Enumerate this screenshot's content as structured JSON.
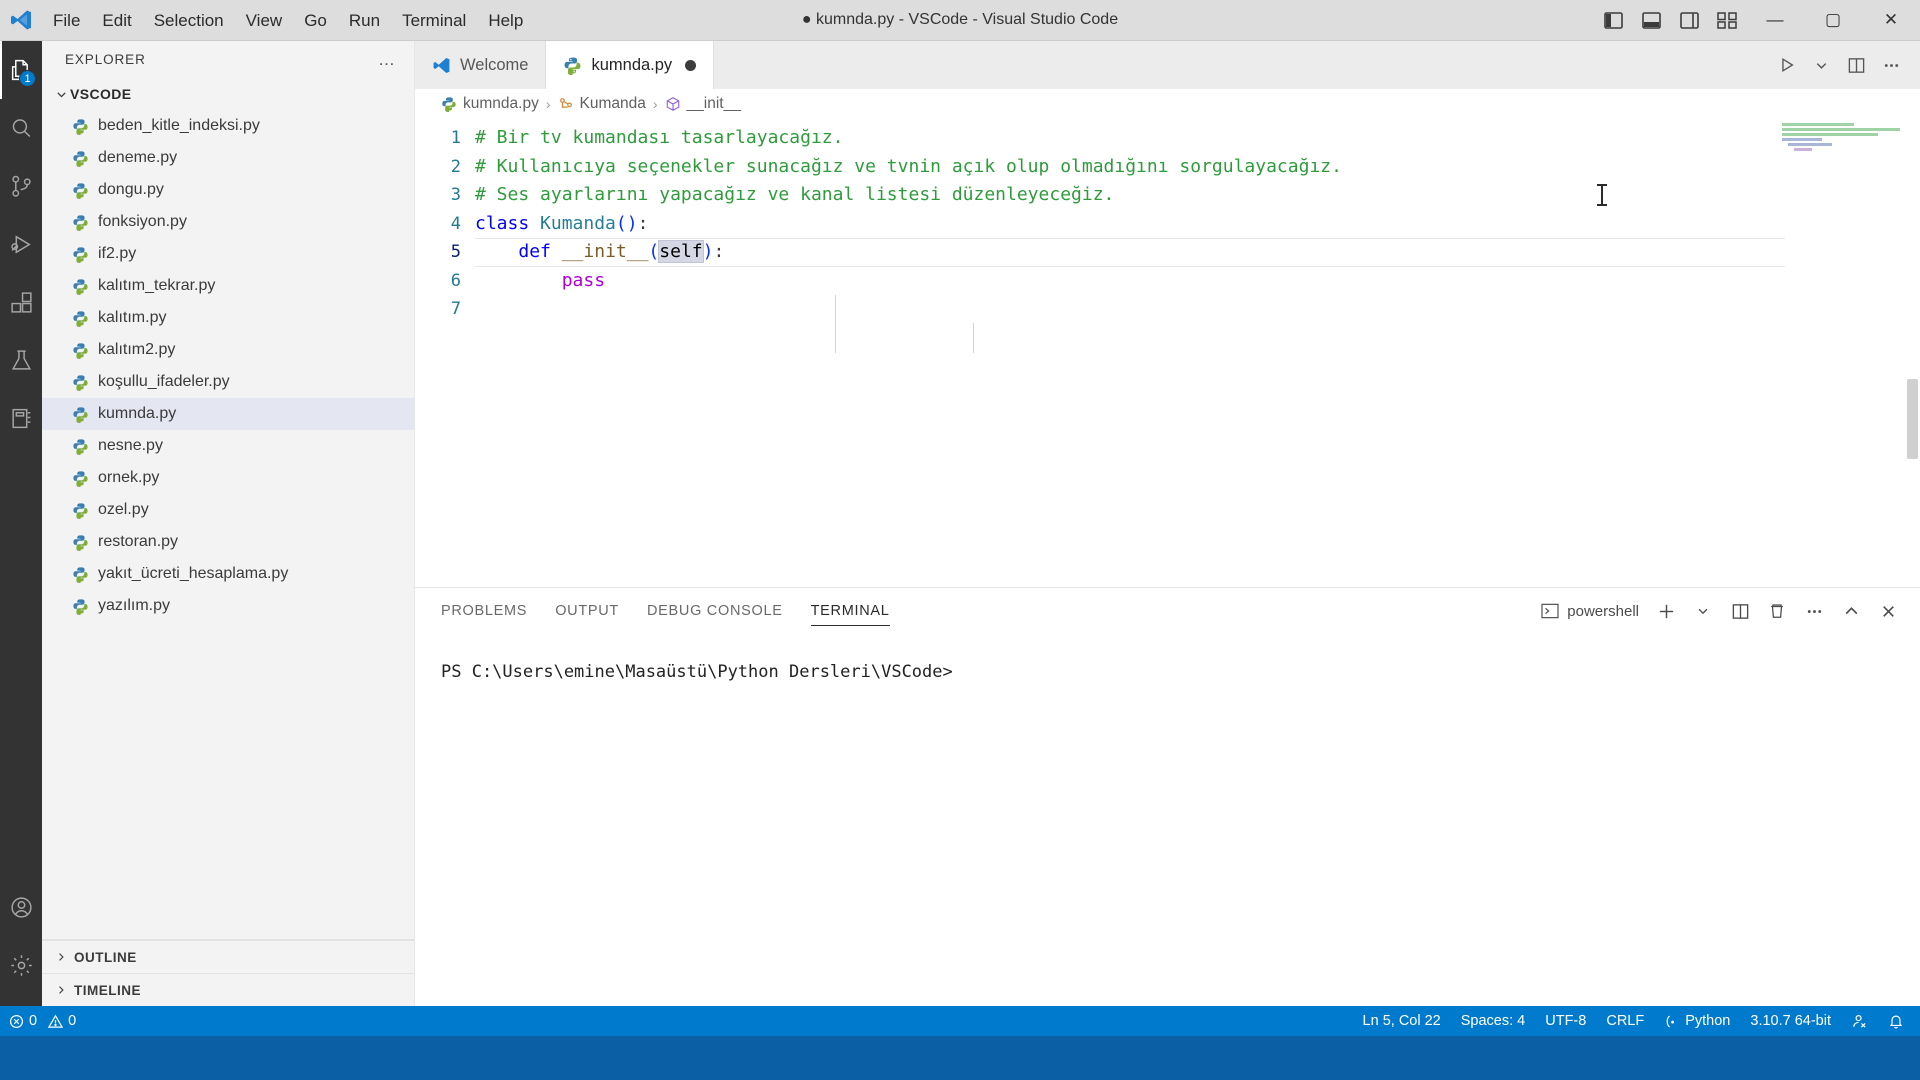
{
  "window": {
    "title": "● kumnda.py - VSCode - Visual Studio Code",
    "menu": [
      "File",
      "Edit",
      "Selection",
      "View",
      "Go",
      "Run",
      "Terminal",
      "Help"
    ],
    "controls": {
      "minimize": "—",
      "maximize": "▢",
      "close": "✕"
    },
    "layout_icons": [
      "panel-left-icon",
      "panel-bottom-icon",
      "panel-right-icon",
      "customize-layout-icon"
    ]
  },
  "activitybar": {
    "items": [
      {
        "name": "explorer",
        "icon": "files-icon",
        "badge": "1",
        "active": true
      },
      {
        "name": "search",
        "icon": "search-icon",
        "active": false
      },
      {
        "name": "source-control",
        "icon": "source-control-icon",
        "active": false
      },
      {
        "name": "run-and-debug",
        "icon": "run-debug-icon",
        "active": false
      },
      {
        "name": "extensions",
        "icon": "extensions-icon",
        "active": false
      },
      {
        "name": "testing",
        "icon": "beaker-icon",
        "active": false
      },
      {
        "name": "notebook",
        "icon": "notebook-icon",
        "active": false
      }
    ],
    "bottom": [
      {
        "name": "accounts",
        "icon": "account-icon"
      },
      {
        "name": "manage",
        "icon": "gear-icon"
      }
    ]
  },
  "sidebar": {
    "title": "EXPLORER",
    "more_actions": "…",
    "root": {
      "label": "VSCODE",
      "expanded": true
    },
    "files": [
      {
        "name": "beden_kitle_indeksi.py",
        "selected": false
      },
      {
        "name": "deneme.py",
        "selected": false
      },
      {
        "name": "dongu.py",
        "selected": false
      },
      {
        "name": "fonksiyon.py",
        "selected": false
      },
      {
        "name": "if2.py",
        "selected": false
      },
      {
        "name": "kalıtım_tekrar.py",
        "selected": false
      },
      {
        "name": "kalıtım.py",
        "selected": false
      },
      {
        "name": "kalıtım2.py",
        "selected": false
      },
      {
        "name": "koşullu_ifadeler.py",
        "selected": false
      },
      {
        "name": "kumnda.py",
        "selected": true
      },
      {
        "name": "nesne.py",
        "selected": false
      },
      {
        "name": "ornek.py",
        "selected": false
      },
      {
        "name": "ozel.py",
        "selected": false
      },
      {
        "name": "restoran.py",
        "selected": false
      },
      {
        "name": "yakıt_ücreti_hesaplama.py",
        "selected": false
      },
      {
        "name": "yazılım.py",
        "selected": false
      }
    ],
    "sections": [
      {
        "label": "OUTLINE",
        "expanded": false
      },
      {
        "label": "TIMELINE",
        "expanded": false
      }
    ]
  },
  "editor": {
    "tabs": [
      {
        "label": "Welcome",
        "icon": "vscode-logo-icon",
        "active": false,
        "dirty": false
      },
      {
        "label": "kumnda.py",
        "icon": "python-icon",
        "active": true,
        "dirty": true
      }
    ],
    "actions": [
      "run-python-file-icon",
      "chevron-down-icon",
      "split-editor-icon",
      "more-actions-icon"
    ],
    "breadcrumb": [
      {
        "label": "kumnda.py",
        "icon": "python-icon"
      },
      {
        "label": "Kumanda",
        "icon": "class-icon"
      },
      {
        "label": "__init__",
        "icon": "method-icon"
      }
    ],
    "lines": [
      {
        "n": 1,
        "text": "# Bir tv kumandası tasarlayacağız."
      },
      {
        "n": 2,
        "text": "# Kullanıcıya seçenekler sunacağız ve tvnin açık olup olmadığını sorgulayacağız."
      },
      {
        "n": 3,
        "text": "# Ses ayarlarını yapacağız ve kanal listesi düzenleyeceğiz."
      },
      {
        "n": 4,
        "text": "class Kumanda():"
      },
      {
        "n": 5,
        "text": "    def __init__(self):"
      },
      {
        "n": 6,
        "text": "        pass"
      },
      {
        "n": 7,
        "text": ""
      }
    ],
    "selection": "self",
    "current_line": 5
  },
  "panel": {
    "tabs": [
      {
        "label": "PROBLEMS",
        "active": false
      },
      {
        "label": "OUTPUT",
        "active": false
      },
      {
        "label": "DEBUG CONSOLE",
        "active": false
      },
      {
        "label": "TERMINAL",
        "active": true
      }
    ],
    "shell": "powershell",
    "actions": [
      "new-terminal-icon",
      "chevron-down-icon",
      "split-terminal-icon",
      "kill-terminal-icon",
      "more-actions-icon",
      "maximize-panel-icon",
      "close-panel-icon"
    ],
    "terminal_prompt": "PS C:\\Users\\emine\\Masaüstü\\Python Dersleri\\VSCode>"
  },
  "statusbar": {
    "errors": "0",
    "warnings": "0",
    "cursor_position": "Ln 5, Col 22",
    "indentation": "Spaces: 4",
    "encoding": "UTF-8",
    "eol": "CRLF",
    "language": "Python",
    "interpreter": "3.10.7 64-bit",
    "remote_icon": "remote-icon",
    "bell_icon": "bell-icon"
  },
  "colors": {
    "accent": "#007acc",
    "activitybar_bg": "#333333",
    "sidebar_bg": "#f3f3f3",
    "editor_bg": "#ffffff",
    "comment": "#2e9c3a",
    "keyword": "#0000ff",
    "class_name": "#267f99",
    "function": "#795e26",
    "selection": "#d5d8e4"
  }
}
